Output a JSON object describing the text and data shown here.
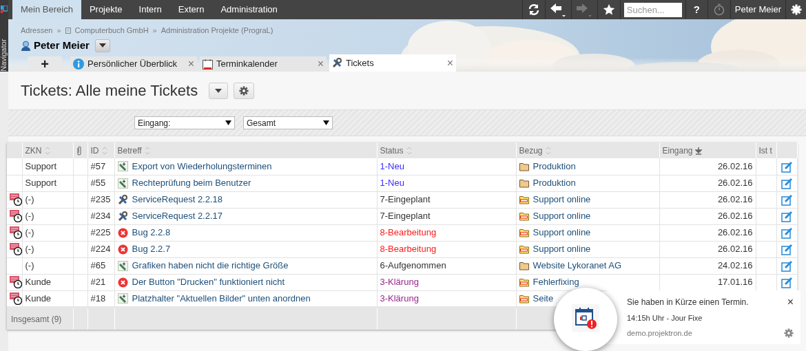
{
  "navigator": {
    "label": "Navigator"
  },
  "menu": [
    {
      "label": "Mein Bereich",
      "selected": true
    },
    {
      "label": "Projekte",
      "selected": false
    },
    {
      "label": "Intern",
      "selected": false
    },
    {
      "label": "Extern",
      "selected": false
    },
    {
      "label": "Administration",
      "selected": false
    }
  ],
  "toolbar": {
    "search": {
      "placeholder": "Suchen..."
    },
    "help": "?",
    "user": "Peter Meier",
    "forward_disabled": true
  },
  "breadcrumb": [
    "Adressen",
    "Computerbuch GmbH",
    "Administration Projekte (PrograL)"
  ],
  "breadcrumb_separator": "»",
  "person": "Peter Meier",
  "add_tab": "+",
  "tabs": [
    {
      "label": "Persönlicher Überblick",
      "kind": "info",
      "selected": false,
      "close": "×"
    },
    {
      "label": "Terminkalender",
      "kind": "calendar",
      "selected": false,
      "close": "×"
    },
    {
      "label": "Tickets",
      "kind": "tools",
      "selected": true,
      "close": "×"
    }
  ],
  "page_title": "Tickets: Alle meine Tickets",
  "filters": [
    {
      "value": "Eingang:"
    },
    {
      "value": "Gesamt"
    }
  ],
  "table": {
    "columns": [
      {
        "sortable": false,
        "sorted": false
      },
      {
        "label": "ZKN",
        "sortable": true,
        "sorted": false
      },
      {
        "kind": "attachment",
        "sortable": false,
        "sorted": false
      },
      {
        "label": "ID",
        "sortable": true,
        "sorted": false
      },
      {
        "label": "Betreff",
        "sortable": true,
        "sorted": false
      },
      {
        "label": "Status",
        "sortable": true,
        "sorted": false
      },
      {
        "label": "Bezug",
        "sortable": true,
        "sorted": false
      },
      {
        "label": "Eingang",
        "sortable": true,
        "sorted": true
      },
      {
        "label": "Ist t",
        "sortable": false,
        "sorted": false
      },
      {
        "sortable": false,
        "sorted": false
      }
    ],
    "rows": [
      {
        "reminder": false,
        "zkn": "Support",
        "id": "#57",
        "kind": "task",
        "subject": "Export von Wiederholungsterminen",
        "status": "1-Neu",
        "color": "#3b2bff",
        "ref_project": false,
        "ref": "Produktion",
        "date": "26.02.16",
        "edit": true
      },
      {
        "reminder": false,
        "zkn": "Support",
        "id": "#55",
        "kind": "task",
        "subject": "Rechteprüfung beim Benutzer",
        "status": "1-Neu",
        "color": "#3b2bff",
        "ref_project": false,
        "ref": "Produktion",
        "date": "26.02.16",
        "edit": true
      },
      {
        "reminder": true,
        "zkn": "(-)",
        "id": "#235",
        "kind": "service",
        "subject": "ServiceRequest 2.2.18",
        "status": "7-Eingeplant",
        "color": "#333333",
        "ref_project": true,
        "ref": "Support online",
        "date": "26.02.16",
        "edit": true
      },
      {
        "reminder": true,
        "zkn": "(-)",
        "id": "#234",
        "kind": "service",
        "subject": "ServiceRequest 2.2.17",
        "status": "7-Eingeplant",
        "color": "#333333",
        "ref_project": true,
        "ref": "Support online",
        "date": "26.02.16",
        "edit": true
      },
      {
        "reminder": true,
        "zkn": "(-)",
        "id": "#225",
        "kind": "bug",
        "subject": "Bug 2.2.8",
        "status": "8-Bearbeitung",
        "color": "#ff1a1a",
        "ref_project": true,
        "ref": "Support online",
        "date": "26.02.16",
        "edit": true
      },
      {
        "reminder": true,
        "zkn": "(-)",
        "id": "#224",
        "kind": "bug",
        "subject": "Bug 2.2.7",
        "status": "8-Bearbeitung",
        "color": "#ff1a1a",
        "ref_project": true,
        "ref": "Support online",
        "date": "26.02.16",
        "edit": true
      },
      {
        "reminder": false,
        "zkn": "(-)",
        "id": "#65",
        "kind": "task",
        "subject": "Grafiken haben nicht die richtige Größe",
        "status": "6-Aufgenommen",
        "color": "#333333",
        "ref_project": false,
        "ref": "Website Lykoranet AG",
        "date": "24.02.16",
        "edit": true
      },
      {
        "reminder": true,
        "zkn": "Kunde",
        "id": "#21",
        "kind": "bug",
        "subject": "Der Button \"Drucken\" funktioniert nicht",
        "status": "3-Klärung",
        "color": "#99258f",
        "ref_project": true,
        "ref": "Fehlerfixing",
        "date": "17.01.16",
        "edit": true
      },
      {
        "reminder": true,
        "zkn": "Kunde",
        "id": "#18",
        "kind": "task",
        "subject": "Platzhalter \"Aktuellen Bilder\" unten anordnen",
        "status": "3-Klärung",
        "color": "#99258f",
        "ref_project": true,
        "ref": "Seite",
        "edit": false
      }
    ],
    "footer": "Insgesamt (9)"
  },
  "notification": {
    "title": "Sie haben in Kürze einen Termin.",
    "detail": "14:15h Uhr - Jour Fixe",
    "source": "demo.projektron.de",
    "close": "×"
  }
}
